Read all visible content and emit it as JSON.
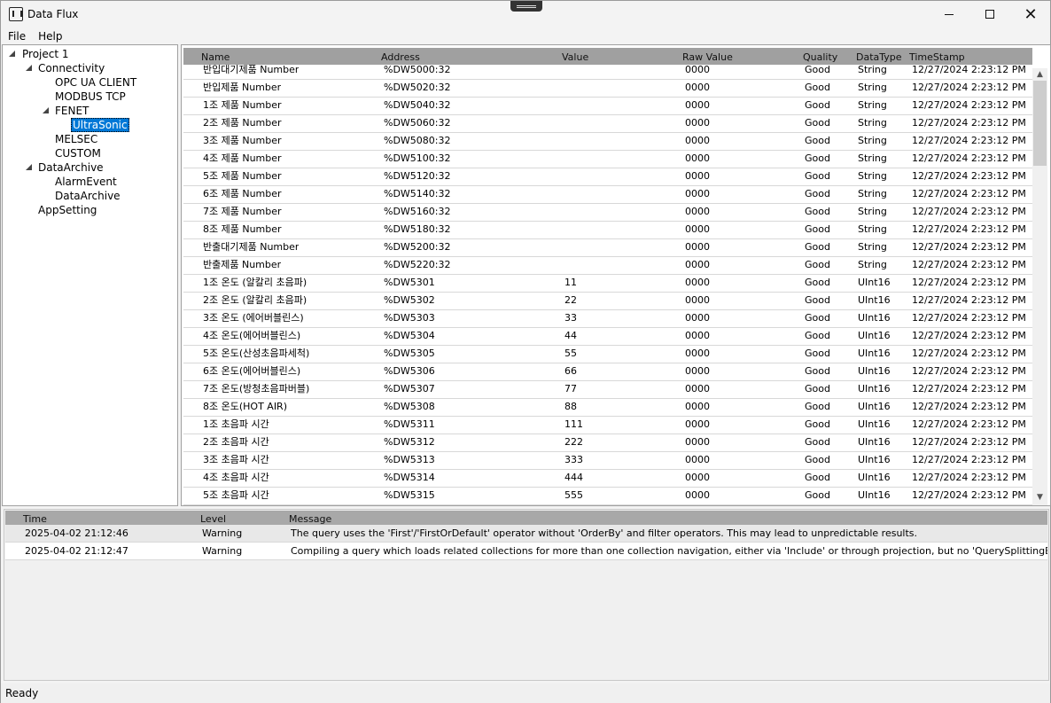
{
  "window": {
    "title": "Data Flux"
  },
  "menu": {
    "file": "File",
    "help": "Help"
  },
  "tree": {
    "project": "Project 1",
    "connectivity": "Connectivity",
    "opc": "OPC UA CLIENT",
    "modbus": "MODBUS TCP",
    "fenet": "FENET",
    "ultrasonic": "UltraSonic",
    "melsec": "MELSEC",
    "custom": "CUSTOM",
    "dataarchive": "DataArchive",
    "alarmevent": "AlarmEvent",
    "dataarchive_child": "DataArchive",
    "appsetting": "AppSetting"
  },
  "grid": {
    "columns": [
      "Name",
      "Address",
      "Value",
      "Raw Value",
      "Quality",
      "DataType",
      "TimeStamp"
    ],
    "rows": [
      [
        "반입대기제품 Number",
        "%DW5000:32",
        "",
        "0000",
        "Good",
        "String",
        "12/27/2024 2:23:12 PM"
      ],
      [
        "반입제품 Number",
        "%DW5020:32",
        "",
        "0000",
        "Good",
        "String",
        "12/27/2024 2:23:12 PM"
      ],
      [
        "1조 제품 Number",
        "%DW5040:32",
        "",
        "0000",
        "Good",
        "String",
        "12/27/2024 2:23:12 PM"
      ],
      [
        "2조 제품 Number",
        "%DW5060:32",
        "",
        "0000",
        "Good",
        "String",
        "12/27/2024 2:23:12 PM"
      ],
      [
        "3조 제품 Number",
        "%DW5080:32",
        "",
        "0000",
        "Good",
        "String",
        "12/27/2024 2:23:12 PM"
      ],
      [
        "4조 제품 Number",
        "%DW5100:32",
        "",
        "0000",
        "Good",
        "String",
        "12/27/2024 2:23:12 PM"
      ],
      [
        "5조 제품 Number",
        "%DW5120:32",
        "",
        "0000",
        "Good",
        "String",
        "12/27/2024 2:23:12 PM"
      ],
      [
        "6조 제품 Number",
        "%DW5140:32",
        "",
        "0000",
        "Good",
        "String",
        "12/27/2024 2:23:12 PM"
      ],
      [
        "7조 제품 Number",
        "%DW5160:32",
        "",
        "0000",
        "Good",
        "String",
        "12/27/2024 2:23:12 PM"
      ],
      [
        "8조 제품 Number",
        "%DW5180:32",
        "",
        "0000",
        "Good",
        "String",
        "12/27/2024 2:23:12 PM"
      ],
      [
        "반출대기제품 Number",
        "%DW5200:32",
        "",
        "0000",
        "Good",
        "String",
        "12/27/2024 2:23:12 PM"
      ],
      [
        "반출제품 Number",
        "%DW5220:32",
        "",
        "0000",
        "Good",
        "String",
        "12/27/2024 2:23:12 PM"
      ],
      [
        "1조 온도 (알칼리 초음파)",
        "%DW5301",
        "11",
        "0000",
        "Good",
        "UInt16",
        "12/27/2024 2:23:12 PM"
      ],
      [
        "2조 온도 (알칼리 초음파)",
        "%DW5302",
        "22",
        "0000",
        "Good",
        "UInt16",
        "12/27/2024 2:23:12 PM"
      ],
      [
        "3조 온도 (에어버블린스)",
        "%DW5303",
        "33",
        "0000",
        "Good",
        "UInt16",
        "12/27/2024 2:23:12 PM"
      ],
      [
        "4조 온도(에어버블린스)",
        "%DW5304",
        "44",
        "0000",
        "Good",
        "UInt16",
        "12/27/2024 2:23:12 PM"
      ],
      [
        "5조 온도(산성초음파세척)",
        "%DW5305",
        "55",
        "0000",
        "Good",
        "UInt16",
        "12/27/2024 2:23:12 PM"
      ],
      [
        "6조 온도(에어버블린스)",
        "%DW5306",
        "66",
        "0000",
        "Good",
        "UInt16",
        "12/27/2024 2:23:12 PM"
      ],
      [
        "7조 온도(방청초음파버블)",
        "%DW5307",
        "77",
        "0000",
        "Good",
        "UInt16",
        "12/27/2024 2:23:12 PM"
      ],
      [
        "8조 온도(HOT AIR)",
        "%DW5308",
        "88",
        "0000",
        "Good",
        "UInt16",
        "12/27/2024 2:23:12 PM"
      ],
      [
        "1조 초음파 시간",
        "%DW5311",
        "111",
        "0000",
        "Good",
        "UInt16",
        "12/27/2024 2:23:12 PM"
      ],
      [
        "2조 초음파 시간",
        "%DW5312",
        "222",
        "0000",
        "Good",
        "UInt16",
        "12/27/2024 2:23:12 PM"
      ],
      [
        "3조 초음파 시간",
        "%DW5313",
        "333",
        "0000",
        "Good",
        "UInt16",
        "12/27/2024 2:23:12 PM"
      ],
      [
        "4조 초음파 시간",
        "%DW5314",
        "444",
        "0000",
        "Good",
        "UInt16",
        "12/27/2024 2:23:12 PM"
      ],
      [
        "5조 초음파 시간",
        "%DW5315",
        "555",
        "0000",
        "Good",
        "UInt16",
        "12/27/2024 2:23:12 PM"
      ]
    ]
  },
  "log": {
    "columns": [
      "Time",
      "Level",
      "Message"
    ],
    "rows": [
      [
        "2025-04-02 21:12:46",
        "Warning",
        "The query uses the 'First'/'FirstOrDefault' operator without 'OrderBy' and filter operators. This may lead to unpredictable results."
      ],
      [
        "2025-04-02 21:12:47",
        "Warning",
        "Compiling a query which loads related collections for more than one collection navigation, either via 'Include' or through projection, but no 'QuerySplittingBehavior' has been con"
      ]
    ]
  },
  "status": {
    "text": "Ready"
  },
  "colors": {
    "selection": "#0078d7",
    "header": "#a0a0a0"
  }
}
